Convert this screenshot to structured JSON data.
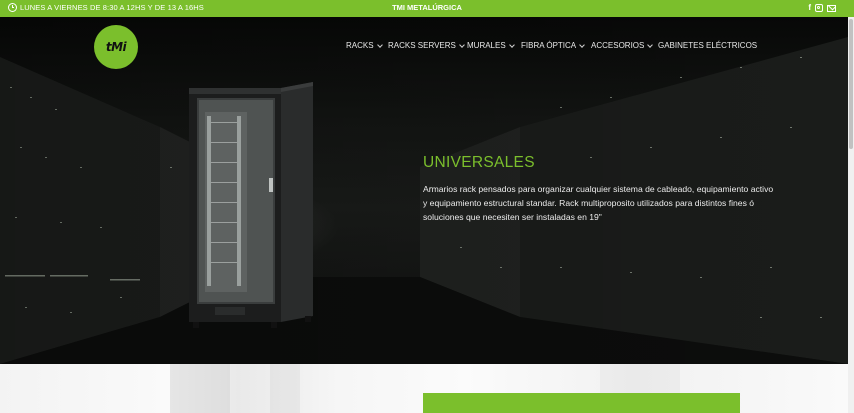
{
  "topbar": {
    "hours": "LUNES A VIERNES DE 8:30 A 12HS Y DE 13 A 16HS",
    "brand": "TMI METALÚRGICA",
    "social": [
      "facebook-icon",
      "instagram-icon",
      "mail-icon"
    ],
    "facebook_glyph": "f"
  },
  "logo": {
    "text": "tMi"
  },
  "nav": {
    "items": [
      {
        "label": "RACKS"
      },
      {
        "label": "RACKS SERVERS"
      },
      {
        "label": "MURALES"
      },
      {
        "label": "FIBRA ÓPTICA"
      },
      {
        "label": "ACCESORIOS"
      },
      {
        "label": "GABINETES ELÉCTRICOS"
      }
    ]
  },
  "hero": {
    "title": "UNIVERSALES",
    "description": "Armarios rack pensados para organizar cualquier sistema de cableado, equipamiento activo y equipamiento estructural standar. Rack multiproposito utilizados para distintos fines ó soluciones que necesiten ser instaladas en 19\""
  },
  "colors": {
    "accent": "#7bbf2c",
    "hero_bg": "#121312",
    "text_light": "#ececec"
  }
}
